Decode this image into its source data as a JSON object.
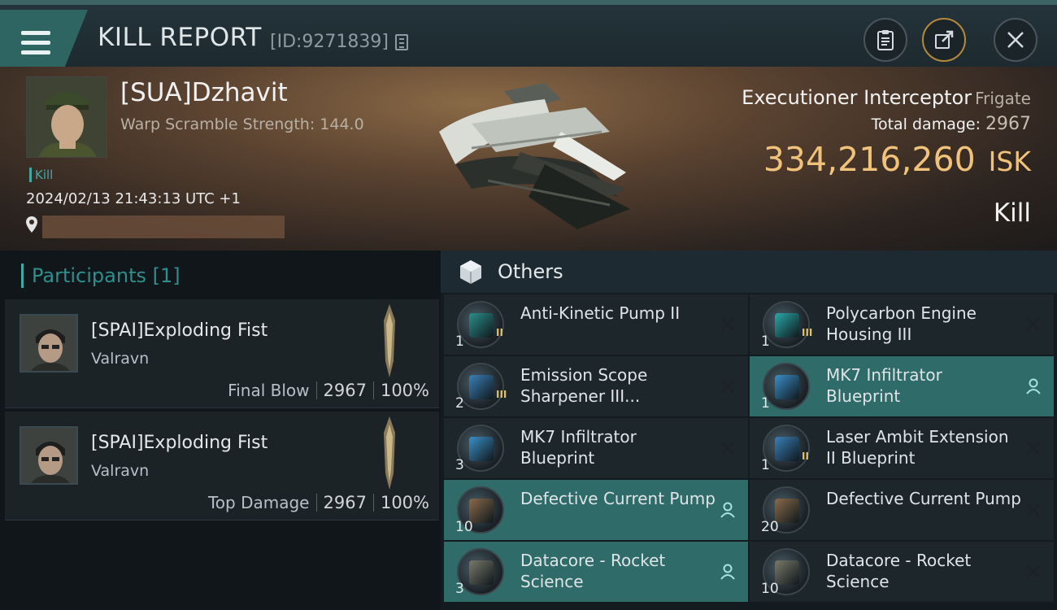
{
  "header": {
    "title": "KILL REPORT",
    "report_id": "[ID:9271839]"
  },
  "victim": {
    "name": "[SUA]Dzhavit",
    "warp_scramble": "Warp Scramble Strength: 144.0",
    "tag": "Kill",
    "datetime": "2024/02/13 21:43:13 UTC +1",
    "ship_name": "Executioner Interceptor",
    "ship_class": "Frigate",
    "total_damage_label": "Total damage:",
    "total_damage_value": "2967",
    "isk_value": "334,216,260",
    "isk_unit": "ISK",
    "result": "Kill"
  },
  "participants": {
    "header": "Participants [1]",
    "items": [
      {
        "name": "[SPAI]Exploding Fist",
        "ship": "Valravn",
        "role": "Final Blow",
        "damage": "2967",
        "percent": "100%"
      },
      {
        "name": "[SPAI]Exploding Fist",
        "ship": "Valravn",
        "role": "Top Damage",
        "damage": "2967",
        "percent": "100%"
      }
    ]
  },
  "others": {
    "header": "Others",
    "left": [
      {
        "name": "Anti-Kinetic Pump II",
        "qty": "1",
        "meta": "II",
        "highlighted": false,
        "icon_color": "#2a8f8c"
      },
      {
        "name": "Emission Scope Sharpener III...",
        "qty": "2",
        "meta": "III",
        "highlighted": false,
        "icon_color": "#3a7fb8"
      },
      {
        "name": "MK7 Infiltrator Blueprint",
        "qty": "3",
        "meta": "",
        "highlighted": false,
        "icon_color": "#3a8fc8"
      },
      {
        "name": "Defective Current Pump",
        "qty": "10",
        "meta": "",
        "highlighted": true,
        "icon_color": "#8a6a4a"
      },
      {
        "name": "Datacore - Rocket Science",
        "qty": "3",
        "meta": "",
        "highlighted": true,
        "icon_color": "#7a7a6a"
      }
    ],
    "right": [
      {
        "name": "Polycarbon Engine Housing III",
        "qty": "1",
        "meta": "III",
        "highlighted": false,
        "icon_color": "#2aa8a8"
      },
      {
        "name": "MK7 Infiltrator Blueprint",
        "qty": "1",
        "meta": "",
        "highlighted": true,
        "icon_color": "#3a8fc8"
      },
      {
        "name": "Laser Ambit Extension II Blueprint",
        "qty": "1",
        "meta": "II",
        "highlighted": false,
        "icon_color": "#3a7fb8"
      },
      {
        "name": "Defective Current Pump",
        "qty": "20",
        "meta": "",
        "highlighted": false,
        "icon_color": "#8a6a4a"
      },
      {
        "name": "Datacore - Rocket Science",
        "qty": "10",
        "meta": "",
        "highlighted": false,
        "icon_color": "#7a7a6a"
      }
    ]
  }
}
